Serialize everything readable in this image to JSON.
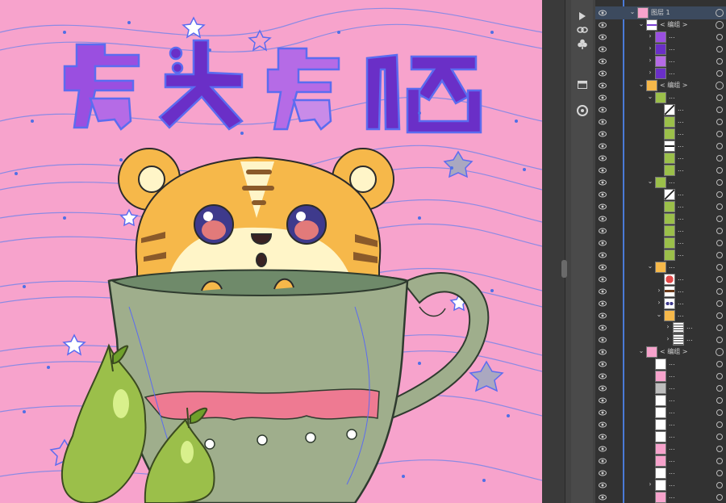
{
  "artwork": {
    "title_text": "虎头虎脑",
    "colors": {
      "background": "#f7a3cc",
      "title_purple": "#7a3fd1",
      "title_light": "#b46be0",
      "tiger_orange": "#f6b84a",
      "tiger_cream": "#fff5c8",
      "cup_green": "#9fae8c",
      "cup_dark": "#6f8a6a",
      "band_pink": "#ee7a92",
      "pear_green": "#9bbf4a",
      "selection_blue": "#4f6fe6"
    }
  },
  "right_dock": {
    "tool_icons": [
      "play-icon",
      "link-icon",
      "club-icon",
      "panel-icon",
      "color-wheel-icon"
    ]
  },
  "layers_panel": {
    "rows": [
      {
        "indent": 0,
        "chevron": "down",
        "thumb": "pink-folder",
        "label": "图层 1",
        "selected": true,
        "target": "big"
      },
      {
        "indent": 1,
        "chevron": "down",
        "thumb": "title",
        "label": "< 编组 >",
        "target": "big"
      },
      {
        "indent": 2,
        "chevron": "right",
        "thumb": "char1",
        "label": "...",
        "target": "small"
      },
      {
        "indent": 2,
        "chevron": "right",
        "thumb": "char2",
        "label": "...",
        "target": "small"
      },
      {
        "indent": 2,
        "chevron": "right",
        "thumb": "char3",
        "label": "...",
        "target": "small"
      },
      {
        "indent": 2,
        "chevron": "right",
        "thumb": "char4",
        "label": "...",
        "target": "small"
      },
      {
        "indent": 1,
        "chevron": "down",
        "thumb": "tiger",
        "label": "< 编组 >",
        "target": "big"
      },
      {
        "indent": 2,
        "chevron": "down",
        "thumb": "leaf",
        "label": "...",
        "target": "small"
      },
      {
        "indent": 3,
        "chevron": "",
        "thumb": "line",
        "label": "...",
        "target": "small"
      },
      {
        "indent": 3,
        "chevron": "",
        "thumb": "leaf",
        "label": "...",
        "target": "small"
      },
      {
        "indent": 3,
        "chevron": "",
        "thumb": "leaf",
        "label": "...",
        "target": "small"
      },
      {
        "indent": 3,
        "chevron": "",
        "thumb": "bar",
        "label": "...",
        "target": "small"
      },
      {
        "indent": 3,
        "chevron": "",
        "thumb": "leaf",
        "label": "...",
        "target": "small"
      },
      {
        "indent": 3,
        "chevron": "",
        "thumb": "leaf",
        "label": "...",
        "target": "small"
      },
      {
        "indent": 2,
        "chevron": "down",
        "thumb": "leaf",
        "label": "...",
        "target": "small"
      },
      {
        "indent": 3,
        "chevron": "",
        "thumb": "line",
        "label": "...",
        "target": "small"
      },
      {
        "indent": 3,
        "chevron": "",
        "thumb": "leaf",
        "label": "...",
        "target": "small"
      },
      {
        "indent": 3,
        "chevron": "",
        "thumb": "leaf",
        "label": "...",
        "target": "small"
      },
      {
        "indent": 3,
        "chevron": "",
        "thumb": "leaf",
        "label": "...",
        "target": "small"
      },
      {
        "indent": 3,
        "chevron": "",
        "thumb": "leaf",
        "label": "...",
        "target": "small"
      },
      {
        "indent": 3,
        "chevron": "",
        "thumb": "leaf",
        "label": "...",
        "target": "small"
      },
      {
        "indent": 2,
        "chevron": "down",
        "thumb": "tiger",
        "label": "...",
        "target": "small"
      },
      {
        "indent": 3,
        "chevron": "",
        "thumb": "red-dot",
        "label": "...",
        "target": "small"
      },
      {
        "indent": 3,
        "chevron": "right",
        "thumb": "face",
        "label": "...",
        "target": "small"
      },
      {
        "indent": 3,
        "chevron": "right",
        "thumb": "eyes",
        "label": "...",
        "target": "small"
      },
      {
        "indent": 3,
        "chevron": "down",
        "thumb": "tiger",
        "label": "...",
        "target": "small"
      },
      {
        "indent": 4,
        "chevron": "right",
        "thumb": "lines",
        "label": "...",
        "target": "small"
      },
      {
        "indent": 4,
        "chevron": "right",
        "thumb": "lines",
        "label": "...",
        "target": "small"
      },
      {
        "indent": 1,
        "chevron": "down",
        "thumb": "pink",
        "label": "< 编组 >",
        "target": "big"
      },
      {
        "indent": 2,
        "chevron": "",
        "thumb": "white",
        "label": "...",
        "target": "small"
      },
      {
        "indent": 2,
        "chevron": "",
        "thumb": "pink",
        "label": "...",
        "target": "small"
      },
      {
        "indent": 2,
        "chevron": "",
        "thumb": "grey",
        "label": "...",
        "target": "small"
      },
      {
        "indent": 2,
        "chevron": "",
        "thumb": "white",
        "label": "...",
        "target": "small"
      },
      {
        "indent": 2,
        "chevron": "",
        "thumb": "white",
        "label": "...",
        "target": "small"
      },
      {
        "indent": 2,
        "chevron": "",
        "thumb": "white",
        "label": "...",
        "target": "small"
      },
      {
        "indent": 2,
        "chevron": "",
        "thumb": "white",
        "label": "...",
        "target": "small"
      },
      {
        "indent": 2,
        "chevron": "",
        "thumb": "pink",
        "label": "...",
        "target": "small"
      },
      {
        "indent": 2,
        "chevron": "",
        "thumb": "pink",
        "label": "...",
        "target": "small"
      },
      {
        "indent": 2,
        "chevron": "",
        "thumb": "white",
        "label": "...",
        "target": "small"
      },
      {
        "indent": 2,
        "chevron": "right",
        "thumb": "white",
        "label": "...",
        "target": "small"
      },
      {
        "indent": 2,
        "chevron": "",
        "thumb": "pink",
        "label": "...",
        "target": "small"
      }
    ]
  }
}
